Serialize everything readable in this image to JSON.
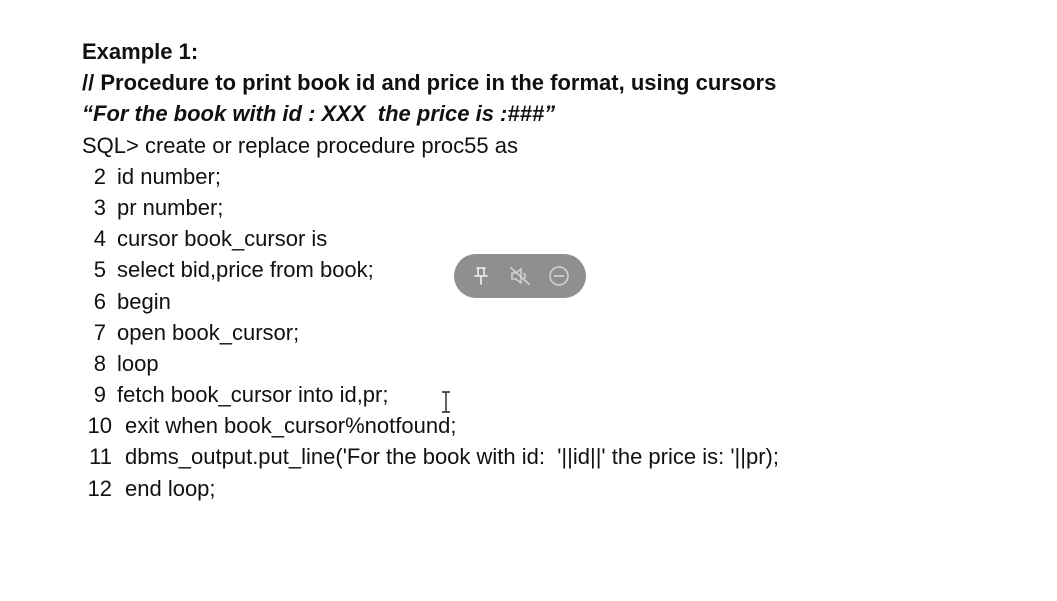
{
  "slide": {
    "heading": "Example 1:",
    "comment": "// Procedure to print book id and price in the format, using cursors",
    "format": "“For the book with id : XXX  the price is :###”",
    "sql_prompt": "SQL> create or replace procedure proc55 as",
    "code_lines": [
      {
        "num": "2",
        "text": "id number;"
      },
      {
        "num": "3",
        "text": "pr number;"
      },
      {
        "num": "4",
        "text": "cursor book_cursor is"
      },
      {
        "num": "5",
        "text": "select bid,price from book;"
      },
      {
        "num": "6",
        "text": "begin"
      },
      {
        "num": "7",
        "text": "open book_cursor;"
      },
      {
        "num": "8",
        "text": "loop"
      },
      {
        "num": "9",
        "text": "fetch book_cursor into id,pr;"
      },
      {
        "num": "10",
        "text": "exit when book_cursor%notfound;"
      },
      {
        "num": "11",
        "text": "dbms_output.put_line('For the book with id:  '||id||' the price is: '||pr);"
      },
      {
        "num": "12",
        "text": "end loop;"
      }
    ]
  },
  "toolbar": {
    "icons": [
      "pin-icon",
      "mute-icon",
      "minimize-icon"
    ],
    "background": "#8f8f8f",
    "icon_color": "#d9d9d9"
  },
  "colors": {
    "text": "#111111",
    "background": "#ffffff"
  }
}
